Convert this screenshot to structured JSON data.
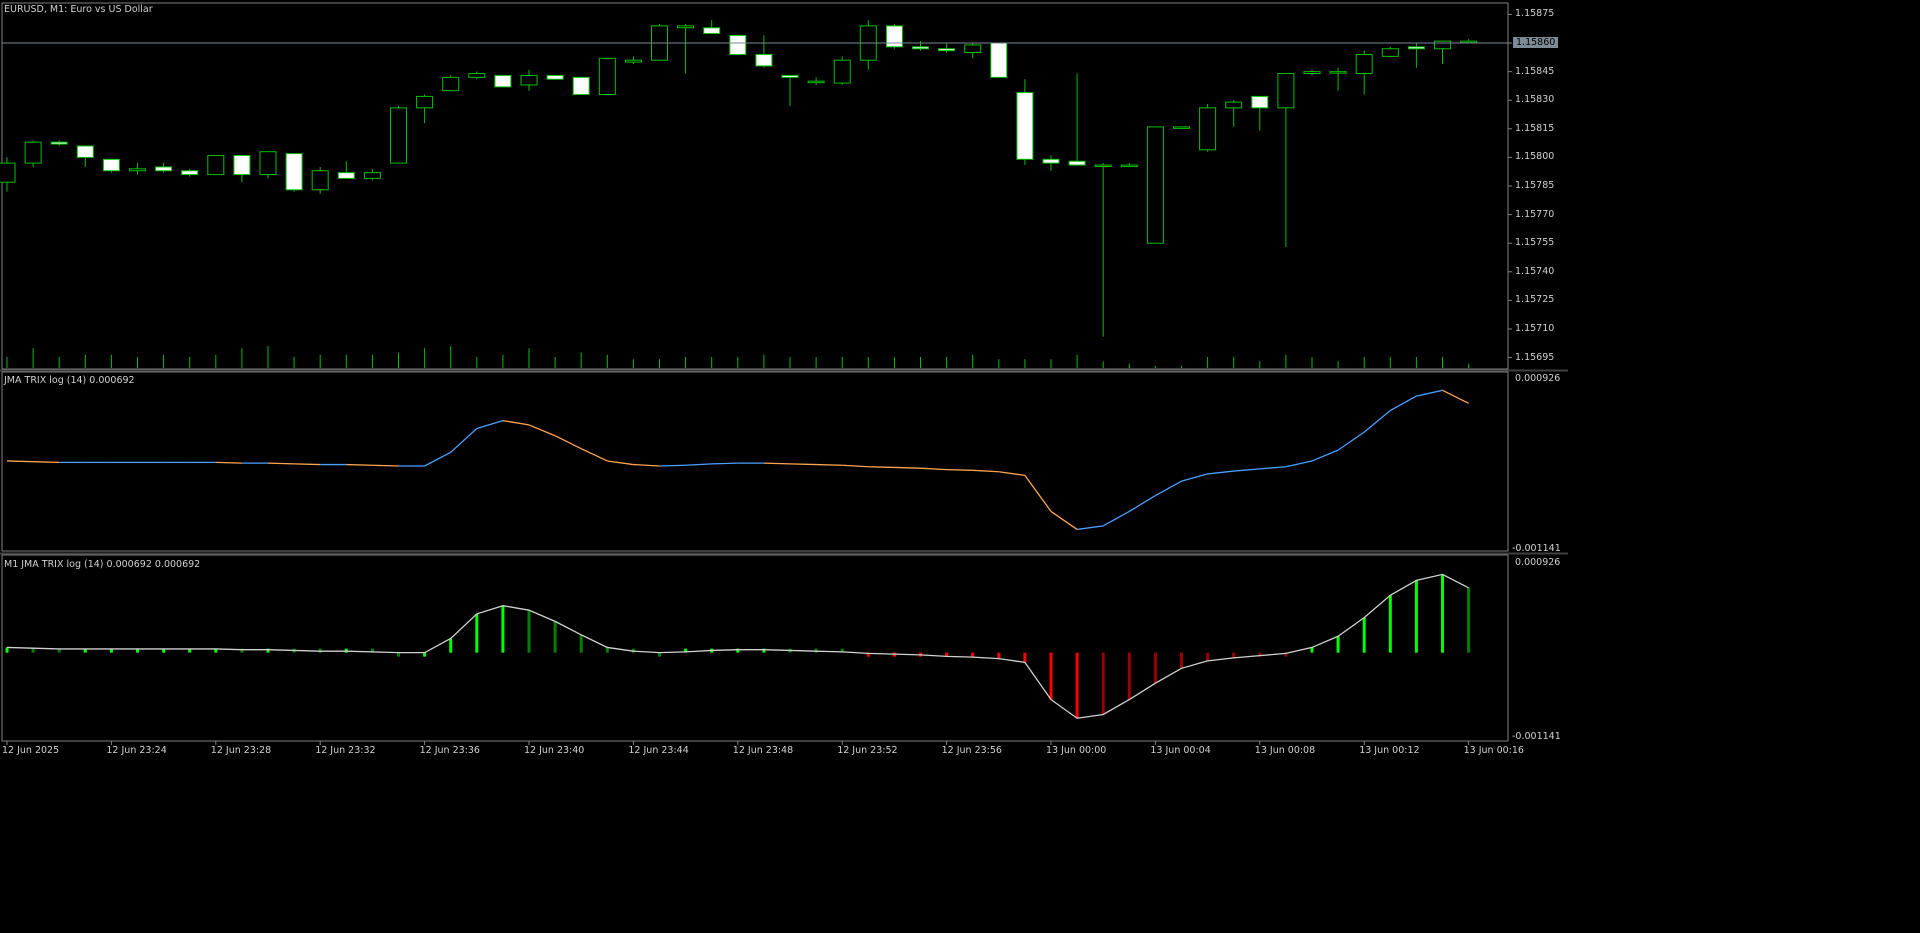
{
  "colors": {
    "background": "#000000",
    "frame": "#808080",
    "candle_border": "#00c000",
    "bull_body": "#000000",
    "bear_body": "#ffffff",
    "volume": "#00c000",
    "current_price_line": "#7d8b96",
    "trix_up": "#4aa0ff",
    "trix_down": "#ffa54f",
    "hist_line": "#d0d0d0",
    "hist_pos_bright": "#00ff00",
    "hist_pos_dark": "#008000",
    "hist_neg_bright": "#ff0000",
    "hist_neg_dark": "#990000"
  },
  "main": {
    "title": "EURUSD, M1:  Euro vs US Dollar",
    "current_price_label": "1.15860",
    "price_ticks": [
      "1.15875",
      "1.15860",
      "1.15845",
      "1.15830",
      "1.15815",
      "1.15800",
      "1.15785",
      "1.15770",
      "1.15755",
      "1.15740",
      "1.15725",
      "1.15710",
      "1.15695"
    ]
  },
  "sub1": {
    "title": "JMA TRIX log (14) 0.000692",
    "tick_top": "0.000926",
    "tick_bottom": "-0.001141"
  },
  "sub2": {
    "title": "M1 JMA TRIX log (14) 0.000692 0.000692",
    "tick_top": "0.000926",
    "tick_bottom": "-0.001141"
  },
  "time_axis": {
    "labels": [
      "12 Jun 2025",
      "12 Jun 23:24",
      "12 Jun 23:28",
      "12 Jun 23:32",
      "12 Jun 23:36",
      "12 Jun 23:40",
      "12 Jun 23:44",
      "12 Jun 23:48",
      "12 Jun 23:52",
      "12 Jun 23:56",
      "13 Jun 00:00",
      "13 Jun 00:04",
      "13 Jun 00:08",
      "13 Jun 00:12",
      "13 Jun 00:16"
    ]
  },
  "chart_data": [
    {
      "type": "candlestick",
      "title": "EURUSD, M1:  Euro vs US Dollar",
      "ylim": [
        1.15689,
        1.15881
      ],
      "candles": [
        {
          "o": 1.15787,
          "h": 1.158,
          "l": 1.15782,
          "c": 1.15797
        },
        {
          "o": 1.15797,
          "h": 1.15809,
          "l": 1.15795,
          "c": 1.15808
        },
        {
          "o": 1.15808,
          "h": 1.15809,
          "l": 1.15806,
          "c": 1.15807
        },
        {
          "o": 1.15806,
          "h": 1.15806,
          "l": 1.15795,
          "c": 1.158
        },
        {
          "o": 1.15799,
          "h": 1.15799,
          "l": 1.15792,
          "c": 1.15793
        },
        {
          "o": 1.15793,
          "h": 1.15797,
          "l": 1.15791,
          "c": 1.15794
        },
        {
          "o": 1.15795,
          "h": 1.15797,
          "l": 1.15792,
          "c": 1.15793
        },
        {
          "o": 1.15793,
          "h": 1.15794,
          "l": 1.1579,
          "c": 1.15791
        },
        {
          "o": 1.15791,
          "h": 1.15801,
          "l": 1.15791,
          "c": 1.15801
        },
        {
          "o": 1.15801,
          "h": 1.15801,
          "l": 1.15787,
          "c": 1.15791
        },
        {
          "o": 1.15791,
          "h": 1.15803,
          "l": 1.15789,
          "c": 1.15803
        },
        {
          "o": 1.15802,
          "h": 1.15802,
          "l": 1.15782,
          "c": 1.15783
        },
        {
          "o": 1.15783,
          "h": 1.15795,
          "l": 1.15781,
          "c": 1.15793
        },
        {
          "o": 1.15792,
          "h": 1.15798,
          "l": 1.15789,
          "c": 1.15789
        },
        {
          "o": 1.15789,
          "h": 1.15794,
          "l": 1.15788,
          "c": 1.15792
        },
        {
          "o": 1.15797,
          "h": 1.15827,
          "l": 1.15797,
          "c": 1.15826
        },
        {
          "o": 1.15826,
          "h": 1.15833,
          "l": 1.15818,
          "c": 1.15832
        },
        {
          "o": 1.15835,
          "h": 1.15843,
          "l": 1.15835,
          "c": 1.15842
        },
        {
          "o": 1.15842,
          "h": 1.15845,
          "l": 1.15841,
          "c": 1.15844
        },
        {
          "o": 1.15843,
          "h": 1.15843,
          "l": 1.15837,
          "c": 1.15837
        },
        {
          "o": 1.15838,
          "h": 1.15846,
          "l": 1.15835,
          "c": 1.15843
        },
        {
          "o": 1.15843,
          "h": 1.15843,
          "l": 1.15841,
          "c": 1.15841
        },
        {
          "o": 1.15842,
          "h": 1.15842,
          "l": 1.15833,
          "c": 1.15833
        },
        {
          "o": 1.15833,
          "h": 1.15852,
          "l": 1.15833,
          "c": 1.15852
        },
        {
          "o": 1.1585,
          "h": 1.15853,
          "l": 1.15849,
          "c": 1.15851
        },
        {
          "o": 1.15851,
          "h": 1.1587,
          "l": 1.15851,
          "c": 1.15869
        },
        {
          "o": 1.15868,
          "h": 1.1587,
          "l": 1.15844,
          "c": 1.15869
        },
        {
          "o": 1.15868,
          "h": 1.15872,
          "l": 1.15865,
          "c": 1.15865
        },
        {
          "o": 1.15864,
          "h": 1.15864,
          "l": 1.15854,
          "c": 1.15854
        },
        {
          "o": 1.15854,
          "h": 1.15864,
          "l": 1.15847,
          "c": 1.15848
        },
        {
          "o": 1.15843,
          "h": 1.15843,
          "l": 1.15827,
          "c": 1.15842
        },
        {
          "o": 1.1584,
          "h": 1.15842,
          "l": 1.15838,
          "c": 1.1584
        },
        {
          "o": 1.15839,
          "h": 1.15853,
          "l": 1.15838,
          "c": 1.15851
        },
        {
          "o": 1.15851,
          "h": 1.15872,
          "l": 1.15846,
          "c": 1.15869
        },
        {
          "o": 1.15869,
          "h": 1.1587,
          "l": 1.15857,
          "c": 1.15858
        },
        {
          "o": 1.15858,
          "h": 1.15861,
          "l": 1.15856,
          "c": 1.15857
        },
        {
          "o": 1.15857,
          "h": 1.1586,
          "l": 1.15855,
          "c": 1.15856
        },
        {
          "o": 1.15855,
          "h": 1.1586,
          "l": 1.15852,
          "c": 1.15859
        },
        {
          "o": 1.1586,
          "h": 1.1586,
          "l": 1.15842,
          "c": 1.15842
        },
        {
          "o": 1.15834,
          "h": 1.15841,
          "l": 1.15796,
          "c": 1.15799
        },
        {
          "o": 1.15799,
          "h": 1.15801,
          "l": 1.15793,
          "c": 1.15797
        },
        {
          "o": 1.15798,
          "h": 1.15844,
          "l": 1.15796,
          "c": 1.15796
        },
        {
          "o": 1.15796,
          "h": 1.15797,
          "l": 1.15706,
          "c": 1.15796
        },
        {
          "o": 1.15796,
          "h": 1.15797,
          "l": 1.15795,
          "c": 1.15796
        },
        {
          "o": 1.15755,
          "h": 1.15816,
          "l": 1.15755,
          "c": 1.15816
        },
        {
          "o": 1.15816,
          "h": 1.15816,
          "l": 1.15816,
          "c": 1.15816
        },
        {
          "o": 1.15804,
          "h": 1.15828,
          "l": 1.15803,
          "c": 1.15826
        },
        {
          "o": 1.15826,
          "h": 1.1583,
          "l": 1.15816,
          "c": 1.15829
        },
        {
          "o": 1.15832,
          "h": 1.15832,
          "l": 1.15814,
          "c": 1.15826
        },
        {
          "o": 1.15826,
          "h": 1.15844,
          "l": 1.15753,
          "c": 1.15844
        },
        {
          "o": 1.15844,
          "h": 1.15846,
          "l": 1.15843,
          "c": 1.15845
        },
        {
          "o": 1.15845,
          "h": 1.15847,
          "l": 1.15835,
          "c": 1.15845
        },
        {
          "o": 1.15844,
          "h": 1.15856,
          "l": 1.15833,
          "c": 1.15854
        },
        {
          "o": 1.15853,
          "h": 1.15858,
          "l": 1.15853,
          "c": 1.15857
        },
        {
          "o": 1.15858,
          "h": 1.1586,
          "l": 1.15847,
          "c": 1.15857
        },
        {
          "o": 1.15857,
          "h": 1.15861,
          "l": 1.15849,
          "c": 1.15861
        },
        {
          "o": 1.15861,
          "h": 1.15862,
          "l": 1.1586,
          "c": 1.15861
        }
      ],
      "volume_rel": [
        0.5,
        0.9,
        0.5,
        0.6,
        0.6,
        0.5,
        0.6,
        0.5,
        0.6,
        0.9,
        1.0,
        0.5,
        0.6,
        0.6,
        0.6,
        0.7,
        0.9,
        1.0,
        0.5,
        0.6,
        0.9,
        0.5,
        0.7,
        0.6,
        0.4,
        0.4,
        0.5,
        0.5,
        0.5,
        0.6,
        0.5,
        0.5,
        0.5,
        0.5,
        0.5,
        0.5,
        0.5,
        0.6,
        0.4,
        0.4,
        0.4,
        0.6,
        0.3,
        0.2,
        0.1,
        0.1,
        0.5,
        0.5,
        0.3,
        0.6,
        0.5,
        0.3,
        0.5,
        0.5,
        0.5,
        0.5,
        0.2
      ],
      "volume_note": "volume shown as relative bar heights at bottom of main pane"
    },
    {
      "type": "line",
      "title": "JMA TRIX log (14) 0.000692",
      "ylim": [
        -0.001141,
        0.000926
      ],
      "values": [
        -0.0001,
        -0.00011,
        -0.00012,
        -0.00012,
        -0.00012,
        -0.00012,
        -0.00012,
        -0.00012,
        -0.00012,
        -0.00013,
        -0.00013,
        -0.00014,
        -0.00015,
        -0.00015,
        -0.00016,
        -0.00017,
        -0.00017,
        2e-05,
        0.00035,
        0.00046,
        0.0004,
        0.00025,
        7e-05,
        -0.0001,
        -0.00015,
        -0.00017,
        -0.00016,
        -0.00014,
        -0.00013,
        -0.00013,
        -0.00014,
        -0.00015,
        -0.00016,
        -0.00018,
        -0.00019,
        -0.0002,
        -0.00022,
        -0.00023,
        -0.00025,
        -0.0003,
        -0.0008,
        -0.00105,
        -0.001,
        -0.0008,
        -0.00058,
        -0.00038,
        -0.00028,
        -0.00024,
        -0.00021,
        -0.00018,
        -0.0001,
        5e-05,
        0.0003,
        0.0006,
        0.0008,
        0.00088,
        0.0007
      ],
      "color_up": "#4aa0ff",
      "color_down": "#ffa54f"
    },
    {
      "type": "histogram",
      "title": "M1 JMA TRIX log (14) 0.000692 0.000692",
      "ylim": [
        -0.001141,
        0.000926
      ]
    }
  ]
}
